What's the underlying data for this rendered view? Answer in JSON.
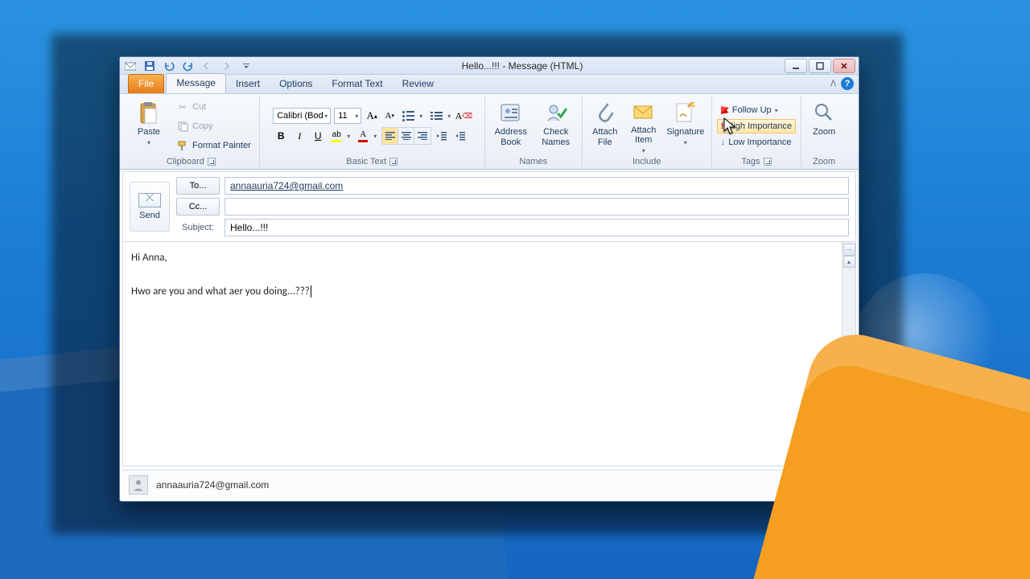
{
  "window": {
    "title": "Hello...!!!  -  Message (HTML)"
  },
  "tabs": {
    "file": "File",
    "message": "Message",
    "insert": "Insert",
    "options": "Options",
    "format_text": "Format Text",
    "review": "Review"
  },
  "ribbon": {
    "clipboard": {
      "paste": "Paste",
      "cut": "Cut",
      "copy": "Copy",
      "format_painter": "Format Painter",
      "label": "Clipboard"
    },
    "basic_text": {
      "font": "Calibri (Bod",
      "size": "11",
      "label": "Basic Text"
    },
    "names": {
      "address_book": "Address\nBook",
      "check_names": "Check\nNames",
      "label": "Names"
    },
    "include": {
      "attach_file": "Attach\nFile",
      "attach_item": "Attach\nItem",
      "signature": "Signature",
      "label": "Include"
    },
    "tags": {
      "follow_up": "Follow Up",
      "high_importance": "High Importance",
      "low_importance": "Low Importance",
      "label": "Tags"
    },
    "zoom": {
      "zoom": "Zoom",
      "label": "Zoom"
    }
  },
  "compose": {
    "send": "Send",
    "to_btn": "To...",
    "cc_btn": "Cc...",
    "subject_lbl": "Subject:",
    "to_value": "annaauria724@gmail.com",
    "cc_value": "",
    "subject_value": "Hello...!!!",
    "body_line1": "Hi Anna,",
    "body_line2": "Hwo are you and what aer you doing...???"
  },
  "people_pane": {
    "contact": "annaauria724@gmail.com"
  },
  "colors": {
    "highlight": "#ffff00",
    "font_color": "#d40000"
  }
}
